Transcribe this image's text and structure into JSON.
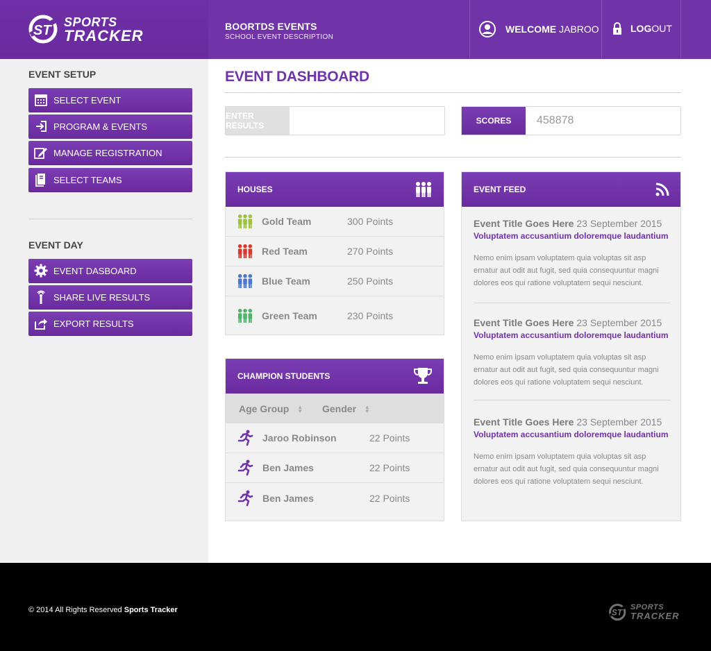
{
  "header": {
    "logo_line1": "SPORTS",
    "logo_line2": "TRACKER",
    "event_name": "BOORTDS EVENTS",
    "event_desc": "SCHOOL EVENT DESCRIPTION",
    "welcome_bold": "WELCOME",
    "welcome_user": "JABROO",
    "logout_bold": "LOG",
    "logout_rest": "OUT"
  },
  "sidebar": {
    "setup_heading": "EVENT SETUP",
    "setup_items": [
      {
        "label": "SELECT EVENT",
        "icon": "calendar-icon"
      },
      {
        "label": "PROGRAM & EVENTS",
        "icon": "sign-in-icon"
      },
      {
        "label": "MANAGE REGISTRATION",
        "icon": "edit-icon"
      },
      {
        "label": "SELECT TEAMS",
        "icon": "book-icon"
      }
    ],
    "day_heading": "EVENT DAY",
    "day_items": [
      {
        "label": "EVENT DASBOARD",
        "icon": "gear-icon"
      },
      {
        "label": "SHARE LIVE RESULTS",
        "icon": "broadcast-icon"
      },
      {
        "label": "EXPORT RESULTS",
        "icon": "share-icon"
      }
    ]
  },
  "main": {
    "title": "EVENT DASHBOARD",
    "enter_results_label": "ENTER RESULTS",
    "enter_results_value": "",
    "scores_label": "SCORES",
    "scores_value": "458878"
  },
  "houses": {
    "title": "HOUSES",
    "icon": "people-icon",
    "rows": [
      {
        "name": "Gold Team",
        "points": "300 Points",
        "color": "#9cc33a"
      },
      {
        "name": "Red Team",
        "points": "270 Points",
        "color": "#d93a2f"
      },
      {
        "name": "Blue Team",
        "points": "250 Points",
        "color": "#4a79c9"
      },
      {
        "name": "Green Team",
        "points": "230 Points",
        "color": "#4fb36e"
      }
    ]
  },
  "champions": {
    "title": "CHAMPION STUDENTS",
    "icon": "trophy-icon",
    "col_age": "Age Group",
    "col_gender": "Gender",
    "rows": [
      {
        "name": "Jaroo Robinson",
        "points": "22 Points"
      },
      {
        "name": "Ben James",
        "points": "22 Points"
      },
      {
        "name": "Ben James",
        "points": "22 Points"
      }
    ]
  },
  "feed": {
    "title": "EVENT FEED",
    "icon": "rss-icon",
    "items": [
      {
        "title": "Event Title Goes Here",
        "date": "23 September 2015",
        "sub": "Voluptatem accusantium doloremque laudantium",
        "body": "Nemo enim ipsam voluptatem quia voluptas sit asp ernatur aut odit aut fugit, sed quia consequuntur magni dolores eos qui ratione voluptatem sequi nesciunt."
      },
      {
        "title": "Event Title Goes Here",
        "date": "23 September 2015",
        "sub": "Voluptatem accusantium doloremque laudantium",
        "body": "Nemo enim ipsam voluptatem quia voluptas sit asp ernatur aut odit aut fugit, sed quia consequuntur magni dolores eos qui ratione voluptatem sequi nesciunt."
      },
      {
        "title": "Event Title Goes Here",
        "date": "23 September 2015",
        "sub": "Voluptatem accusantium doloremque laudantium",
        "body": "Nemo enim ipsam voluptatem quia voluptas sit asp ernatur aut odit aut fugit, sed quia consequuntur magni dolores eos qui ratione voluptatem sequi nesciunt."
      }
    ]
  },
  "footer": {
    "copyright": "© 2014 All Rights Reserved",
    "brand": "Sports Tracker",
    "logo_line1": "SPORTS",
    "logo_line2": "TRACKER"
  },
  "colors": {
    "primary": "#7133a8",
    "sidebar_bg": "#f0f0f0",
    "footer_bg": "#000000"
  }
}
